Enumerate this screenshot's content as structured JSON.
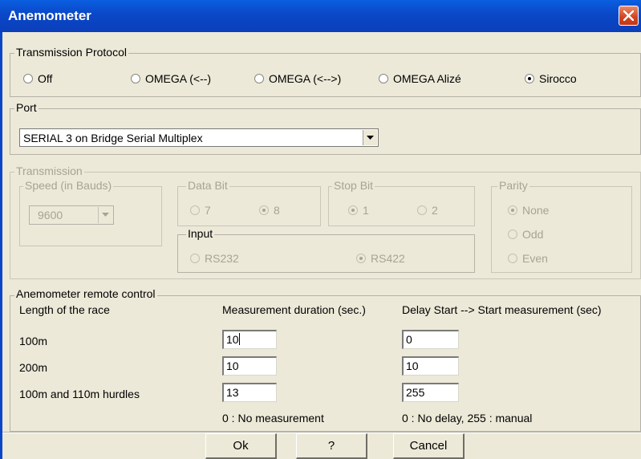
{
  "window": {
    "title": "Anemometer"
  },
  "protocol": {
    "legend": "Transmission Protocol",
    "options": [
      {
        "label": "Off",
        "checked": false
      },
      {
        "label": "OMEGA (<--)",
        "checked": false
      },
      {
        "label": "OMEGA (<-->)",
        "checked": false
      },
      {
        "label": "OMEGA Alizé",
        "checked": false
      },
      {
        "label": "Sirocco",
        "checked": true
      }
    ]
  },
  "port": {
    "legend": "Port",
    "value": "SERIAL 3 on Bridge Serial Multiplex"
  },
  "transmission": {
    "legend": "Transmission",
    "speed": {
      "legend": "Speed (in Bauds)",
      "value": "9600"
    },
    "databit": {
      "legend": "Data Bit",
      "options": [
        {
          "label": "7",
          "checked": false
        },
        {
          "label": "8",
          "checked": true
        }
      ]
    },
    "stopbit": {
      "legend": "Stop Bit",
      "options": [
        {
          "label": "1",
          "checked": true
        },
        {
          "label": "2",
          "checked": false
        }
      ]
    },
    "parity": {
      "legend": "Parity",
      "options": [
        {
          "label": "None",
          "checked": true
        },
        {
          "label": "Odd",
          "checked": false
        },
        {
          "label": "Even",
          "checked": false
        }
      ]
    },
    "input": {
      "legend": "Input",
      "options": [
        {
          "label": "RS232",
          "checked": false
        },
        {
          "label": "RS422",
          "checked": true
        }
      ]
    }
  },
  "remote": {
    "legend": "Anemometer remote control",
    "headers": {
      "race": "Length of the race",
      "duration": "Measurement duration (sec.)",
      "delay": "Delay Start --> Start measurement (sec)"
    },
    "rows": [
      {
        "label": "100m",
        "duration": "10",
        "delay": "0"
      },
      {
        "label": "200m",
        "duration": "10",
        "delay": "10"
      },
      {
        "label": "100m and 110m hurdles",
        "duration": "13",
        "delay": "255"
      }
    ],
    "notes": {
      "duration": "0 : No measurement",
      "delay": "0 : No delay, 255 : manual"
    }
  },
  "buttons": {
    "ok": "Ok",
    "help": "?",
    "cancel": "Cancel"
  }
}
